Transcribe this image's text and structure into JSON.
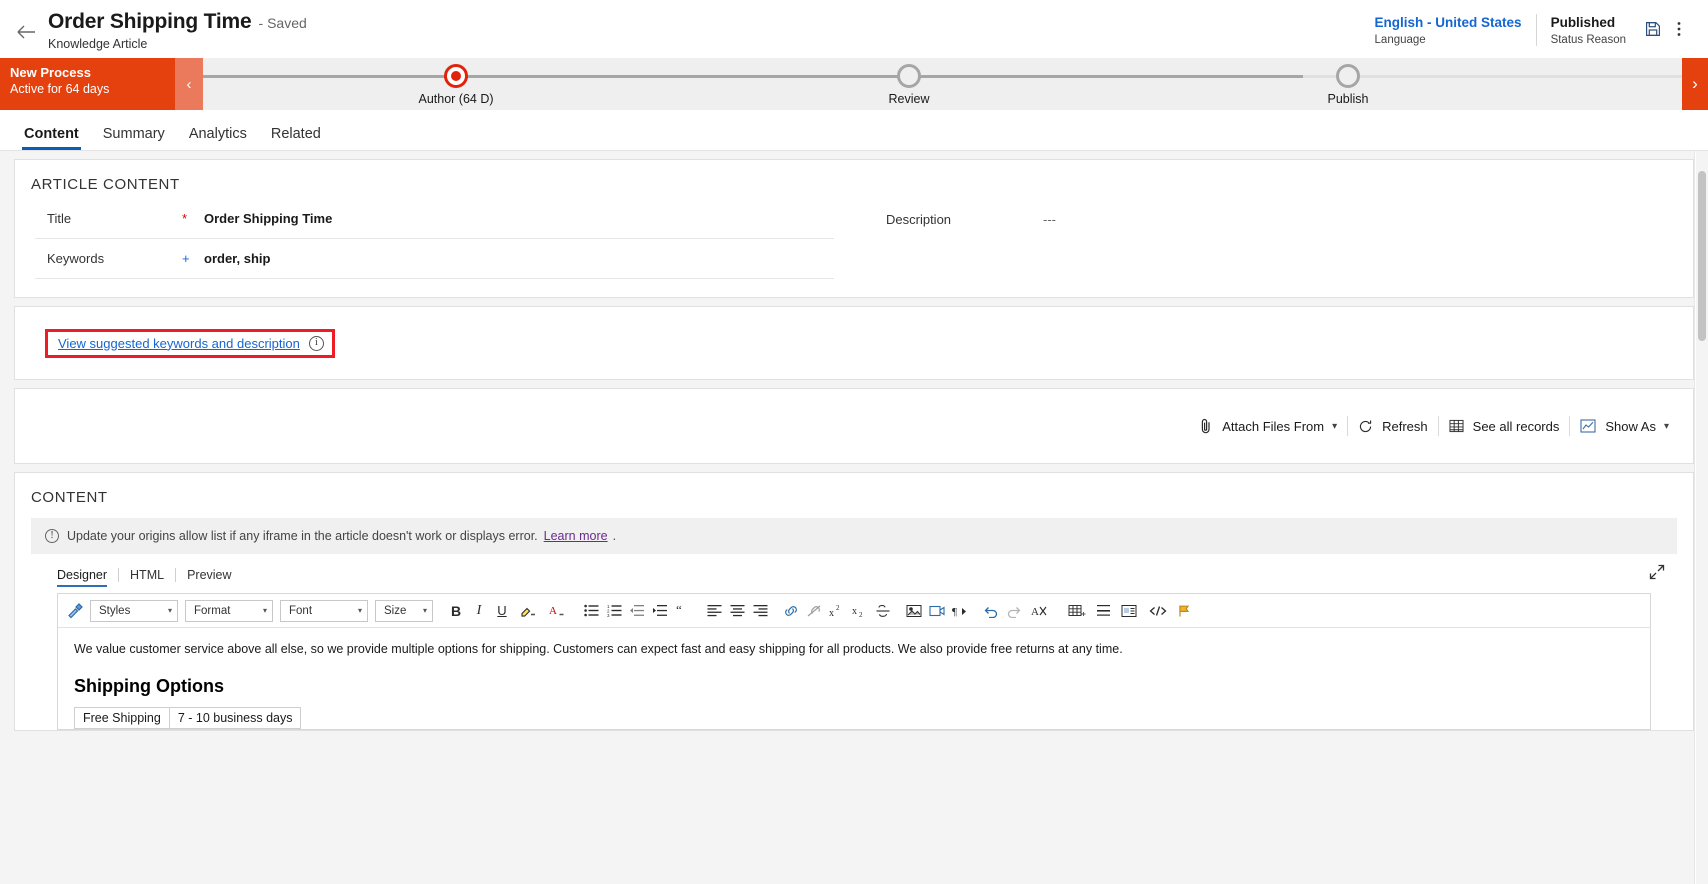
{
  "header": {
    "back_icon": "back-arrow-icon",
    "title": "Order Shipping Time",
    "saved_state": "- Saved",
    "entity": "Knowledge Article",
    "language_value": "English - United States",
    "language_label": "Language",
    "status_value": "Published",
    "status_label": "Status Reason",
    "save_icon": "save-icon",
    "more_icon": "more-vertical-icon"
  },
  "process": {
    "stage_title": "New Process",
    "stage_sub": "Active for 64 days",
    "collapse_icon": "chevron-left-icon",
    "next_icon": "chevron-right-icon",
    "stages": [
      {
        "label": "Author  (64 D)",
        "state": "active"
      },
      {
        "label": "Review",
        "state": "pending"
      },
      {
        "label": "Publish",
        "state": "pending"
      }
    ]
  },
  "tabs": [
    {
      "label": "Content",
      "active": true
    },
    {
      "label": "Summary",
      "active": false
    },
    {
      "label": "Analytics",
      "active": false
    },
    {
      "label": "Related",
      "active": false
    }
  ],
  "article_content": {
    "section_title": "ARTICLE CONTENT",
    "fields_left": [
      {
        "label": "Title",
        "marker": "*",
        "marker_type": "required",
        "value": "Order Shipping Time"
      },
      {
        "label": "Keywords",
        "marker": "+",
        "marker_type": "recommended",
        "value": "order, ship"
      }
    ],
    "fields_right": [
      {
        "label": "Description",
        "marker": "",
        "marker_type": "none",
        "value": "---"
      }
    ]
  },
  "suggestions": {
    "link_text": "View suggested keywords and description",
    "info_icon": "info-circle-icon",
    "highlight_color": "#ee1d24"
  },
  "attachments": {
    "toolbar": [
      {
        "label": "Attach Files From",
        "icon": "paperclip-icon",
        "has_caret": true
      },
      {
        "label": "Refresh",
        "icon": "refresh-icon",
        "has_caret": false
      },
      {
        "label": "See all records",
        "icon": "grid-icon",
        "has_caret": false
      },
      {
        "label": "Show As",
        "icon": "chart-icon",
        "has_caret": true
      }
    ]
  },
  "content_section": {
    "section_title": "CONTENT",
    "notice_icon": "info-circle-icon",
    "notice_text": "Update your origins allow list if any iframe in the article doesn't work or displays error.",
    "notice_link": "Learn more",
    "notice_trailing": ".",
    "editor_tabs": [
      {
        "label": "Designer",
        "active": true
      },
      {
        "label": "HTML",
        "active": false
      },
      {
        "label": "Preview",
        "active": false
      }
    ],
    "expand_icon": "expand-diagonal-icon"
  },
  "rte": {
    "selects": [
      {
        "name": "styles",
        "label": "Styles"
      },
      {
        "name": "format",
        "label": "Format"
      },
      {
        "name": "font",
        "label": "Font"
      },
      {
        "name": "size",
        "label": "Size"
      }
    ],
    "buttons": [
      "format-painter-icon",
      "bold-icon",
      "italic-icon",
      "underline-icon",
      "highlight-color-icon",
      "font-color-icon",
      "bullet-list-icon",
      "numbered-list-icon",
      "decrease-indent-icon",
      "increase-indent-icon",
      "blockquote-icon",
      "align-left-icon",
      "align-center-icon",
      "align-right-icon",
      "insert-link-icon",
      "unlink-icon",
      "superscript-icon",
      "subscript-icon",
      "strikethrough-icon",
      "insert-image-icon",
      "insert-video-icon",
      "rtl-ltr-icon",
      "undo-icon",
      "redo-icon",
      "clear-format-icon",
      "insert-table-icon",
      "horizontal-rule-icon",
      "insert-template-icon",
      "source-code-icon",
      "flag-icon"
    ],
    "body_paragraph": "We value customer service above all else, so we provide multiple options for shipping. Customers can expect fast and easy shipping for all products. We also provide free returns at any time.",
    "body_heading": "Shipping Options",
    "body_table": [
      [
        "Free Shipping",
        "7 - 10 business days"
      ]
    ]
  }
}
